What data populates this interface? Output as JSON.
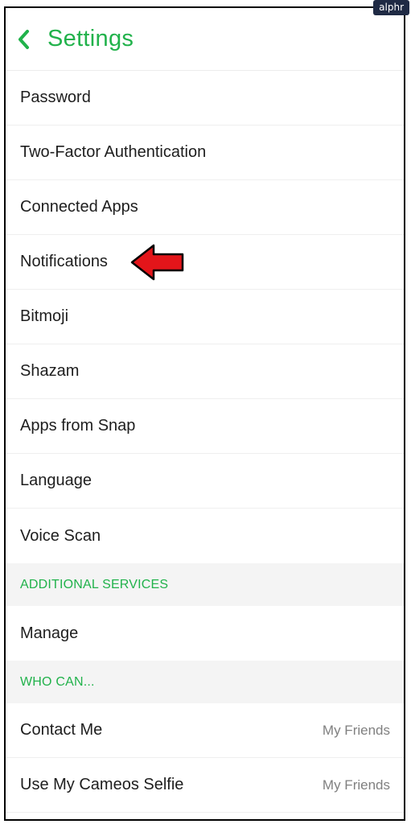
{
  "watermark": "alphr",
  "header": {
    "title": "Settings",
    "back_icon": "chevron-left-icon"
  },
  "rows_top": [
    {
      "label": "Password"
    },
    {
      "label": "Two-Factor Authentication"
    },
    {
      "label": "Connected Apps"
    },
    {
      "label": "Notifications"
    },
    {
      "label": "Bitmoji"
    },
    {
      "label": "Shazam"
    },
    {
      "label": "Apps from Snap"
    },
    {
      "label": "Language"
    },
    {
      "label": "Voice Scan"
    }
  ],
  "sections": {
    "additional_services": "ADDITIONAL SERVICES",
    "who_can": "WHO CAN..."
  },
  "rows_services": [
    {
      "label": "Manage"
    }
  ],
  "rows_who_can": [
    {
      "label": "Contact Me",
      "value": "My Friends"
    },
    {
      "label": "Use My Cameos Selfie",
      "value": "My Friends"
    }
  ],
  "annotation": {
    "icon": "red-arrow-icon",
    "target": "Notifications"
  },
  "colors": {
    "accent": "#21b24b",
    "text": "#1e1e1e",
    "muted": "#808080",
    "section_bg": "#f4f4f4",
    "arrow": "#e3151a",
    "watermark_bg": "#1f2a44"
  }
}
